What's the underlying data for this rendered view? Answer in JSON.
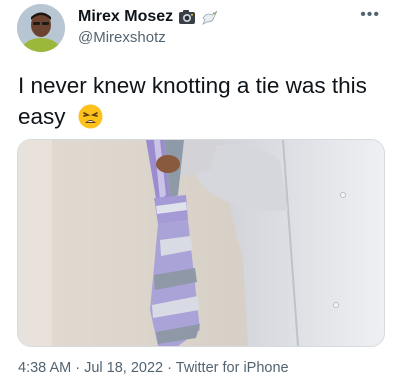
{
  "author": {
    "name": "Mirex Mosez",
    "handle": "@Mirexshotz",
    "badges": [
      "camera-emoji",
      "dove-emoji"
    ]
  },
  "more_icon": "more-horizontal-icon",
  "tweet": {
    "text": "I never knew knotting a tie was this easy",
    "emoji": "weary-face-emoji"
  },
  "media": {
    "subject": "video-frame-person-tying-tie"
  },
  "meta": {
    "time": "4:38 AM",
    "sep1": "·",
    "date": "Jul 18, 2022",
    "sep2": "·",
    "source": "Twitter for iPhone"
  }
}
